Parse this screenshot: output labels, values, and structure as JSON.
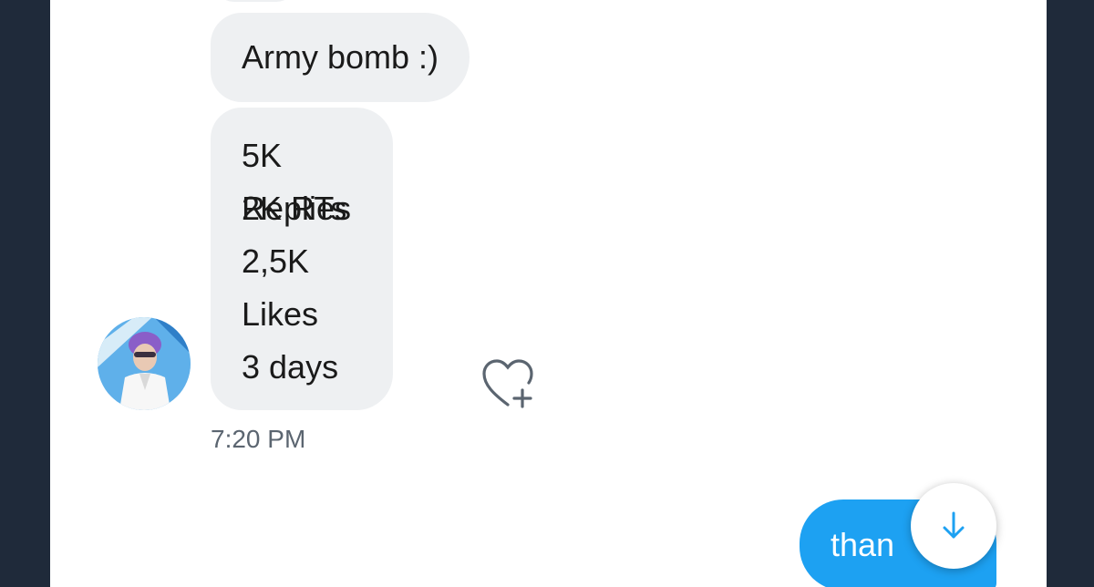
{
  "messages": {
    "received": [
      {
        "text": "Army bomb :)"
      },
      {
        "lines": [
          "5K Replies",
          "2K RTs",
          "2,5K Likes",
          "",
          "3 days"
        ]
      }
    ],
    "timestamp": "7:20 PM",
    "sent_preview": "than"
  },
  "icons": {
    "like": "heart-plus-icon",
    "scroll": "arrow-down-icon"
  },
  "colors": {
    "background": "#1f2a3a",
    "received_bubble": "#eef0f2",
    "sent_bubble": "#1da1f2",
    "accent": "#1da1f2"
  }
}
